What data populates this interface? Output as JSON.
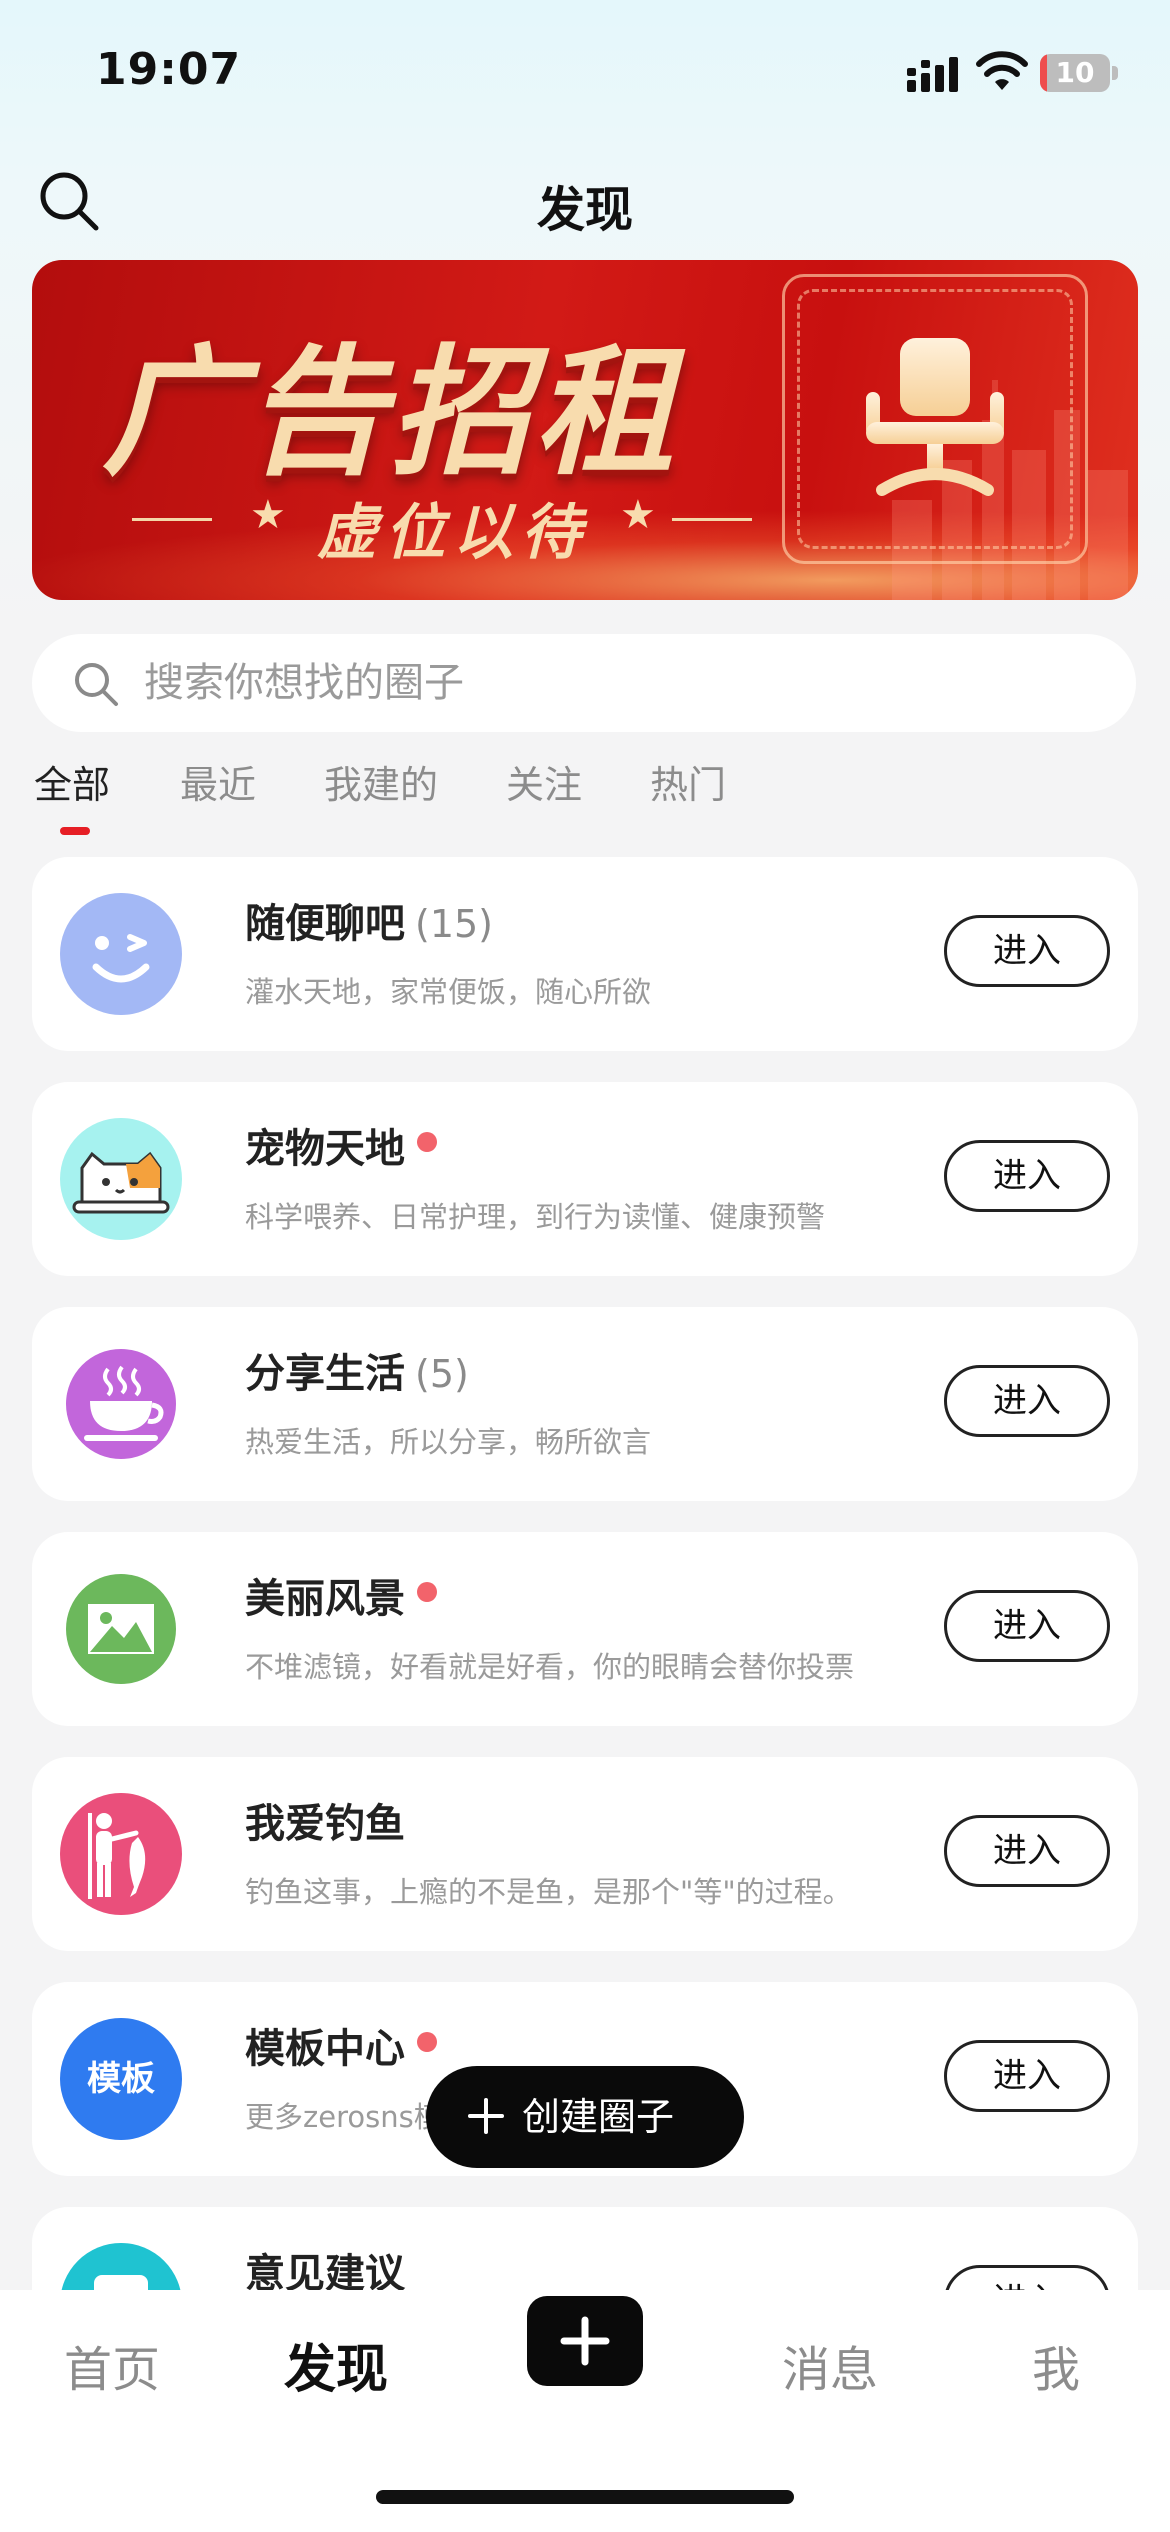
{
  "status_bar": {
    "time": "19:07",
    "battery": "10",
    "battery_level": 0.1
  },
  "header": {
    "title": "发现"
  },
  "banner": {
    "title": "广告招租",
    "subtitle": "虚位以待"
  },
  "search": {
    "placeholder": "搜索你想找的圈子"
  },
  "tabs": [
    {
      "label": "全部",
      "active": true
    },
    {
      "label": "最近",
      "active": false
    },
    {
      "label": "我建的",
      "active": false
    },
    {
      "label": "关注",
      "active": false
    },
    {
      "label": "热门",
      "active": false
    }
  ],
  "circles": [
    {
      "name": "随便聊吧",
      "count": "(15)",
      "desc": "灌水天地，家常便饭，随心所欲",
      "new_dot": false,
      "icon": "wink-face-icon",
      "color": "#a3b8f5",
      "enter": "进入"
    },
    {
      "name": "宠物天地",
      "count": "",
      "desc": "科学喂养、日常护理，到行为读懂、健康预警",
      "new_dot": true,
      "icon": "cat-icon",
      "color": "#a6f2ef",
      "enter": "进入"
    },
    {
      "name": "分享生活",
      "count": "(5)",
      "desc": "热爱生活，所以分享，畅所欲言",
      "new_dot": false,
      "icon": "coffee-cup-icon",
      "color": "#c266db",
      "enter": "进入"
    },
    {
      "name": "美丽风景",
      "count": "",
      "desc": "不堆滤镜，好看就是好看，你的眼睛会替你投票",
      "new_dot": true,
      "icon": "landscape-icon",
      "color": "#6cb85c",
      "enter": "进入"
    },
    {
      "name": "我爱钓鱼",
      "count": "",
      "desc": "钓鱼这事，上瘾的不是鱼，是那个\"等\"的过程。",
      "new_dot": false,
      "icon": "fisherman-icon",
      "color": "#ea4f7b",
      "enter": "进入"
    },
    {
      "name": "模板中心",
      "count": "",
      "desc": "更多zerosns模",
      "new_dot": true,
      "icon": "template-icon",
      "icon_text": "模板",
      "color": "#2f7bf0",
      "enter": "进入"
    },
    {
      "name": "意见建议",
      "count": "",
      "desc": "",
      "new_dot": false,
      "icon": "feedback-icon",
      "color": "#1fc3d1",
      "enter": "进入"
    }
  ],
  "create_button": {
    "label": "创建圈子"
  },
  "tabbar": [
    {
      "label": "首页",
      "active": false
    },
    {
      "label": "发现",
      "active": true
    },
    {
      "label": "消息",
      "active": false
    },
    {
      "label": "我",
      "active": false
    }
  ]
}
